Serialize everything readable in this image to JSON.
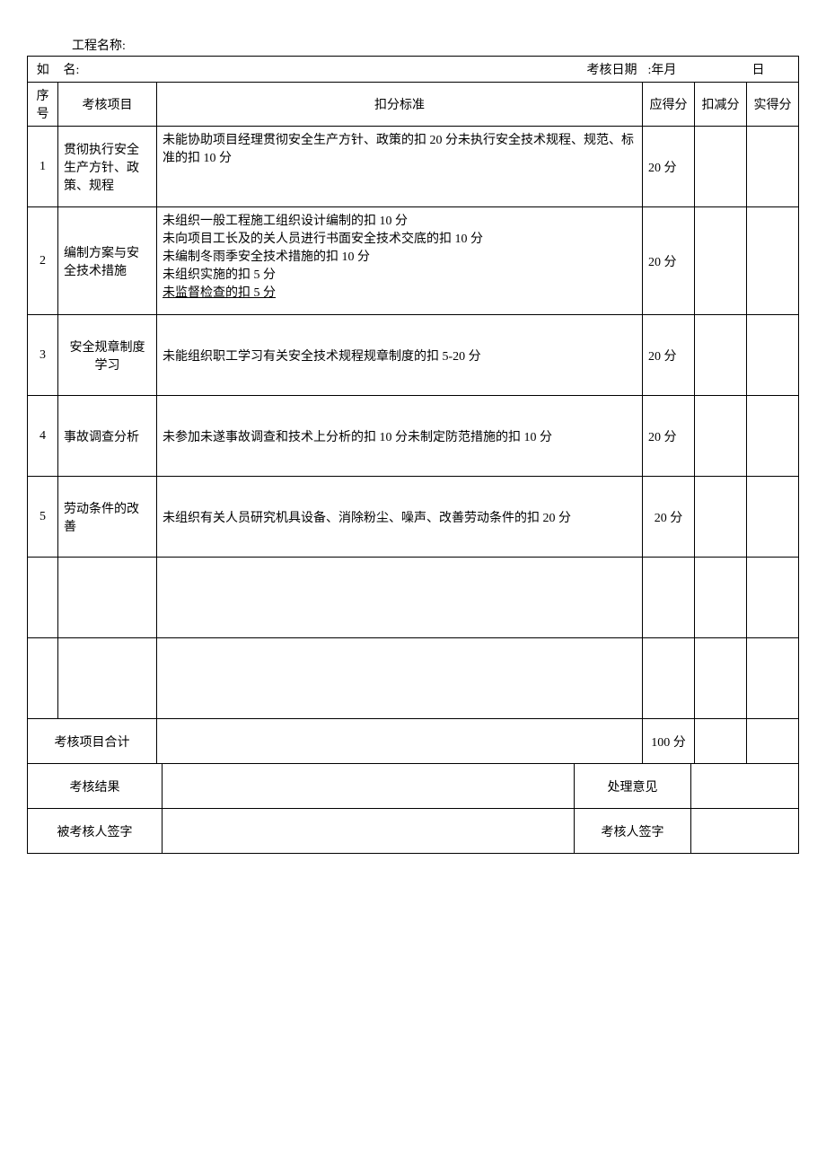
{
  "header": {
    "project_label": "工程名称:",
    "name_prefix": "如",
    "name_label": "名:",
    "date_label": "考核日期",
    "date_sep": ":",
    "year_month": "年月",
    "day": "日"
  },
  "columns": {
    "seq": "序号",
    "item": "考核项目",
    "standard": "扣分标准",
    "should": "应得分",
    "deduct": "扣减分",
    "actual": "实得分"
  },
  "rows": [
    {
      "seq": "1",
      "item": "贯彻执行安全生产方针、政策、规程",
      "standard": "未能协助项目经理贯彻安全生产方针、政策的扣 20 分未执行安全技术规程、规范、标准的扣 10 分",
      "should": "20 分"
    },
    {
      "seq": "2",
      "item": "编制方案与安全技术措施",
      "standard_lines": [
        "未组织一般工程施工组织设计编制的扣 10 分",
        "未向项目工长及的关人员进行书面安全技术交底的扣 10 分",
        "未编制冬雨季安全技术措施的扣 10 分",
        "未组织实施的扣 5 分",
        "未监督检查的扣 5 分"
      ],
      "should": "20 分"
    },
    {
      "seq": "3",
      "item": "安全规章制度学习",
      "standard": "未能组织职工学习有关安全技术规程规章制度的扣 5-20 分",
      "should": "20 分"
    },
    {
      "seq": "4",
      "item": "事故调查分析",
      "standard": "未参加未遂事故调查和技术上分析的扣 10 分未制定防范措施的扣 10 分",
      "should": "20 分"
    },
    {
      "seq": "5",
      "item": "劳动条件的改善",
      "standard": "未组织有关人员研究机具设备、消除粉尘、噪声、改善劳动条件的扣 20 分",
      "should": "20 分"
    }
  ],
  "footer": {
    "total_label": "考核项目合计",
    "total_score": "100 分",
    "result_label": "考核结果",
    "opinion_label": "处理意见",
    "assessee_label": "被考核人签字",
    "assessor_label": "考核人签字"
  }
}
